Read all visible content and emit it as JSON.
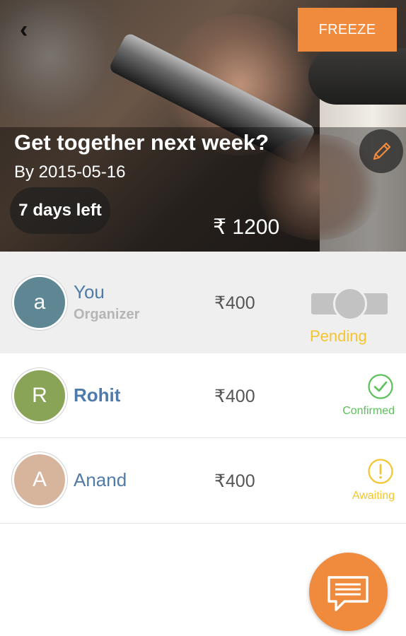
{
  "header": {
    "back_icon": "chevron-left-icon",
    "freeze_label": "FREEZE",
    "title": "Get together next week?",
    "date": "By 2015-05-16",
    "days_left": "7 days left",
    "total": "₹ 1200",
    "edit_icon": "pencil-icon"
  },
  "participants": [
    {
      "initial": "a",
      "name": "You",
      "role": "Organizer",
      "amount": "₹400",
      "status": "Pending",
      "avatar_color": "#5e8693"
    },
    {
      "initial": "R",
      "name": "Rohit",
      "amount": "₹400",
      "status": "Confirmed",
      "status_icon": "check-circle-icon",
      "avatar_color": "#8aa457"
    },
    {
      "initial": "A",
      "name": "Anand",
      "amount": "₹400",
      "status": "Awaiting",
      "status_icon": "alert-circle-icon",
      "avatar_color": "#d7b59c"
    }
  ],
  "fab_icon": "chat-icon",
  "colors": {
    "accent": "#f08a3d",
    "name_blue": "#4f7bab",
    "confirmed_green": "#5cc15a",
    "awaiting_yellow": "#f5c531"
  }
}
